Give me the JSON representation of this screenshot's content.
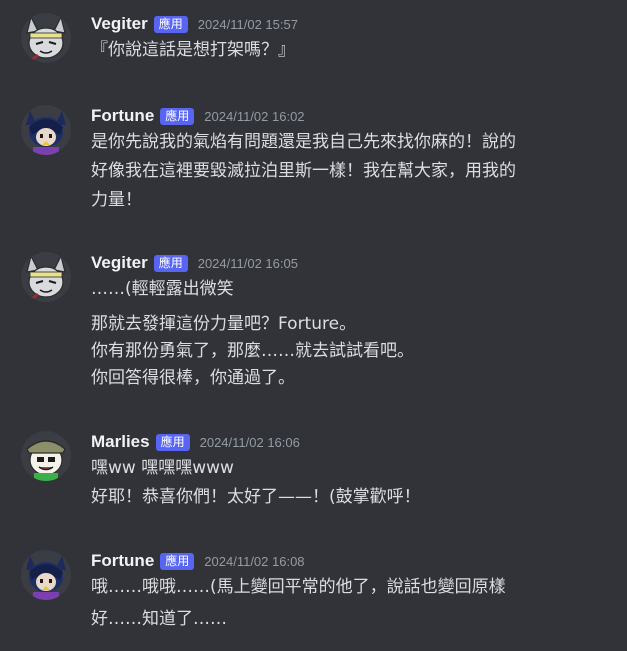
{
  "colors": {
    "background": "#313338",
    "badge": "#5865f2",
    "username": "#f2f3f5",
    "text": "#dbdee1",
    "timestamp": "#949ba4"
  },
  "messages": [
    {
      "username": "Vegiter",
      "badge": "應用",
      "timestamp": "2024/11/02 15:57",
      "avatar_icon": "vegiter-avatar-icon",
      "lines": [
        "『你說這話是想打架嗎？』"
      ]
    },
    {
      "username": "Fortune",
      "badge": "應用",
      "timestamp": "2024/11/02 16:02",
      "avatar_icon": "fortune-avatar-icon",
      "lines": [
        "是你先說我的氣焰有問題還是我自己先來找你麻的！說的",
        "好像我在這裡要毀滅拉泊里斯一樣！我在幫大家，用我的",
        "力量！"
      ]
    },
    {
      "username": "Vegiter",
      "badge": "應用",
      "timestamp": "2024/11/02 16:05",
      "avatar_icon": "vegiter-avatar-icon",
      "lines": [
        "……(輕輕露出微笑",
        "那就去發揮這份力量吧？Forture。",
        "你有那份勇氣了，那麼……就去試試看吧。",
        "你回答得很棒，你通過了。"
      ]
    },
    {
      "username": "Marlies",
      "badge": "應用",
      "timestamp": "2024/11/02 16:06",
      "avatar_icon": "marlies-avatar-icon",
      "lines": [
        "嘿ww 嘿嘿嘿www",
        "好耶！恭喜你們！太好了——！(鼓掌歡呼！"
      ]
    },
    {
      "username": "Fortune",
      "badge": "應用",
      "timestamp": "2024/11/02 16:08",
      "avatar_icon": "fortune-avatar-icon",
      "lines": [
        "哦……哦哦……(馬上變回平常的他了，說話也變回原樣",
        "好……知道了……"
      ]
    }
  ]
}
